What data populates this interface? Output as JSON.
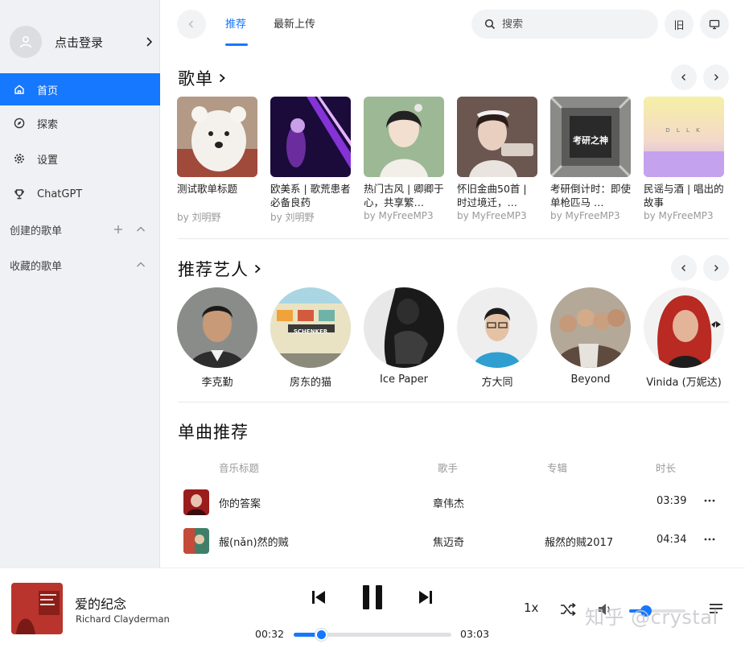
{
  "sidebar": {
    "login_label": "点击登录",
    "nav": [
      {
        "label": "首页",
        "icon": "home-icon",
        "active": true
      },
      {
        "label": "探索",
        "icon": "compass-icon"
      },
      {
        "label": "设置",
        "icon": "gear-icon"
      },
      {
        "label": "ChatGPT",
        "icon": "trophy-icon"
      }
    ],
    "sections": [
      {
        "label": "创建的歌单"
      },
      {
        "label": "收藏的歌单"
      }
    ]
  },
  "header": {
    "tabs": [
      {
        "label": "推荐",
        "active": true
      },
      {
        "label": "最新上传"
      }
    ],
    "search_placeholder": "搜索",
    "mode_button": "旧"
  },
  "playlists": {
    "title": "歌单",
    "items": [
      {
        "title": "测试歌单标题",
        "by": "by 刘明野"
      },
      {
        "title": "欧美系 | 歌荒患者必备良药",
        "by": "by 刘明野"
      },
      {
        "title": "热门古风 | 卿卿于心，共享繁…",
        "by": "by MyFreeMP3"
      },
      {
        "title": "怀旧金曲50首 | 时过境迁，…",
        "by": "by MyFreeMP3"
      },
      {
        "title": "考研倒计时：即使单枪匹马 …",
        "by": "by MyFreeMP3"
      },
      {
        "title": "民谣与酒 | 唱出的故事",
        "by": "by MyFreeMP3"
      }
    ],
    "covers_text": {
      "kaoyan": "考研之神",
      "minyao": "D L L K"
    }
  },
  "artists": {
    "title": "推荐艺人",
    "items": [
      {
        "name": "李克勤"
      },
      {
        "name": "房东的猫"
      },
      {
        "name": "Ice Paper"
      },
      {
        "name": "方大同"
      },
      {
        "name": "Beyond"
      },
      {
        "name": "Vinida (万妮达)"
      }
    ],
    "shop_sign": "SCHENKER"
  },
  "songs": {
    "title": "单曲推荐",
    "headers": {
      "title": "音乐标题",
      "artist": "歌手",
      "album": "专辑",
      "duration": "时长"
    },
    "rows": [
      {
        "title": "你的答案",
        "artist": "章伟杰",
        "album": "",
        "duration": "03:39"
      },
      {
        "title": "赧(nǎn)然的贼",
        "artist": "焦迈奇",
        "album": "赧然的贼2017",
        "duration": "04:34"
      }
    ]
  },
  "player": {
    "title": "爱的纪念",
    "artist": "Richard Clayderman",
    "current": "00:32",
    "total": "03:03",
    "progress": 0.176,
    "speed": "1x",
    "volume": 0.3,
    "watermark": "知乎 @crystal"
  },
  "colors": {
    "accent": "#1677ff",
    "sidebar_bg": "#f0f1f4"
  }
}
